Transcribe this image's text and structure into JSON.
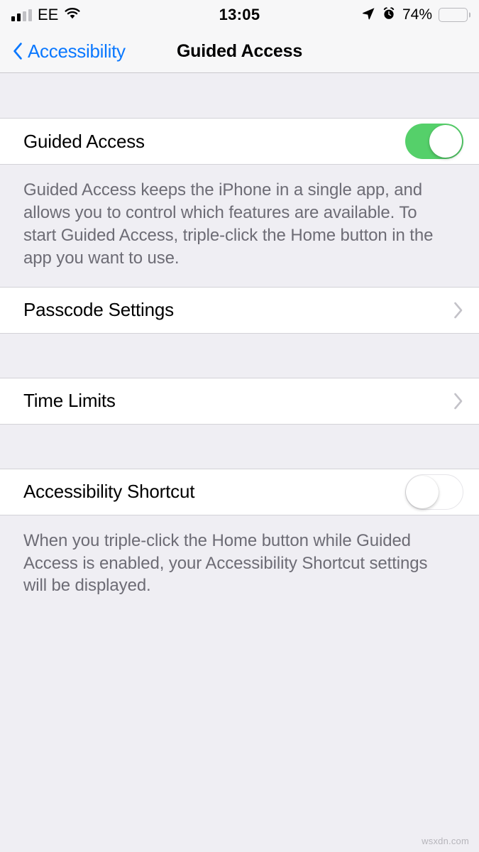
{
  "status_bar": {
    "carrier": "EE",
    "signal_bars_filled": 2,
    "signal_bars_total": 4,
    "wifi_icon": "wifi-icon",
    "time": "13:05",
    "location_icon": "location-arrow-icon",
    "alarm_icon": "alarm-clock-icon",
    "battery_percent_label": "74%",
    "battery_level": 74
  },
  "nav_bar": {
    "back_label": "Accessibility",
    "back_icon": "chevron-left-icon",
    "title": "Guided Access"
  },
  "sections": {
    "guided_access": {
      "row_label": "Guided Access",
      "toggle_state": "on",
      "footer": "Guided Access keeps the iPhone in a single app, and allows you to control which features are available. To start Guided Access, triple-click the Home button in the app you want to use."
    },
    "passcode_settings": {
      "row_label": "Passcode Settings",
      "accessory_icon": "chevron-right-icon"
    },
    "time_limits": {
      "row_label": "Time Limits",
      "accessory_icon": "chevron-right-icon"
    },
    "accessibility_shortcut": {
      "row_label": "Accessibility Shortcut",
      "toggle_state": "off",
      "footer": "When you triple-click the Home button while Guided Access is enabled, your Accessibility Shortcut settings will be displayed."
    }
  },
  "watermark": "wsxdn.com",
  "colors": {
    "accent_blue": "#0a78ff",
    "toggle_on_green": "#55d06a",
    "group_background": "#efeef3",
    "row_background": "#ffffff",
    "footer_text": "#6d6c75"
  }
}
